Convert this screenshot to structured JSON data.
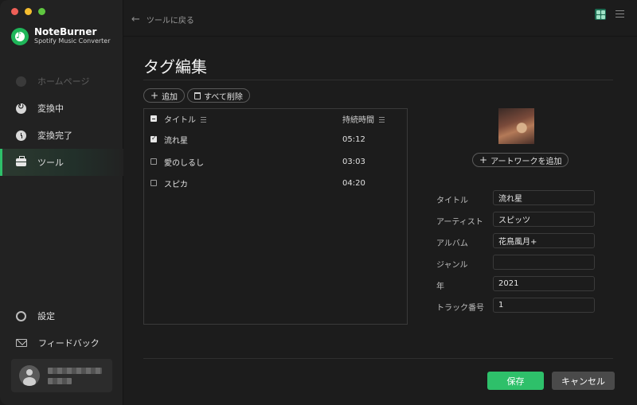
{
  "app": {
    "name": "NoteBurner",
    "subtitle": "Spotify Music Converter"
  },
  "sidebar": {
    "items": [
      {
        "label": "ホームページ",
        "icon": "home-icon",
        "state": "disabled"
      },
      {
        "label": "変換中",
        "icon": "convert-icon",
        "state": "normal"
      },
      {
        "label": "変換完了",
        "icon": "converted-icon",
        "state": "normal"
      },
      {
        "label": "ツール",
        "icon": "toolbox-icon",
        "state": "active"
      }
    ],
    "bottom_items": [
      {
        "label": "設定",
        "icon": "gear-icon"
      },
      {
        "label": "フィードバック",
        "icon": "mail-icon"
      }
    ]
  },
  "topbar": {
    "back_label": "ツールに戻る"
  },
  "page": {
    "title": "タグ編集"
  },
  "toolbar": {
    "add_label": "追加",
    "delete_all_label": "すべて削除"
  },
  "track_table": {
    "headers": {
      "title": "タイトル",
      "duration": "持続時間"
    },
    "rows": [
      {
        "title": "流れ星",
        "duration": "05:12",
        "checked": true
      },
      {
        "title": "愛のしるし",
        "duration": "03:03",
        "checked": false
      },
      {
        "title": "スピカ",
        "duration": "04:20",
        "checked": false
      }
    ]
  },
  "artwork": {
    "add_label": "アートワークを追加"
  },
  "tags": {
    "title": {
      "label": "タイトル",
      "value": "流れ星"
    },
    "artist": {
      "label": "アーティスト",
      "value": "スピッツ"
    },
    "album": {
      "label": "アルバム",
      "value": "花鳥風月+"
    },
    "genre": {
      "label": "ジャンル",
      "value": ""
    },
    "year": {
      "label": "年",
      "value": "2021"
    },
    "track": {
      "label": "トラック番号",
      "value": "1"
    }
  },
  "footer": {
    "save_label": "保存",
    "cancel_label": "キャンセル"
  },
  "colors": {
    "accent": "#2ec06a",
    "background": "#1c1c1c",
    "sidebar": "#222222"
  }
}
